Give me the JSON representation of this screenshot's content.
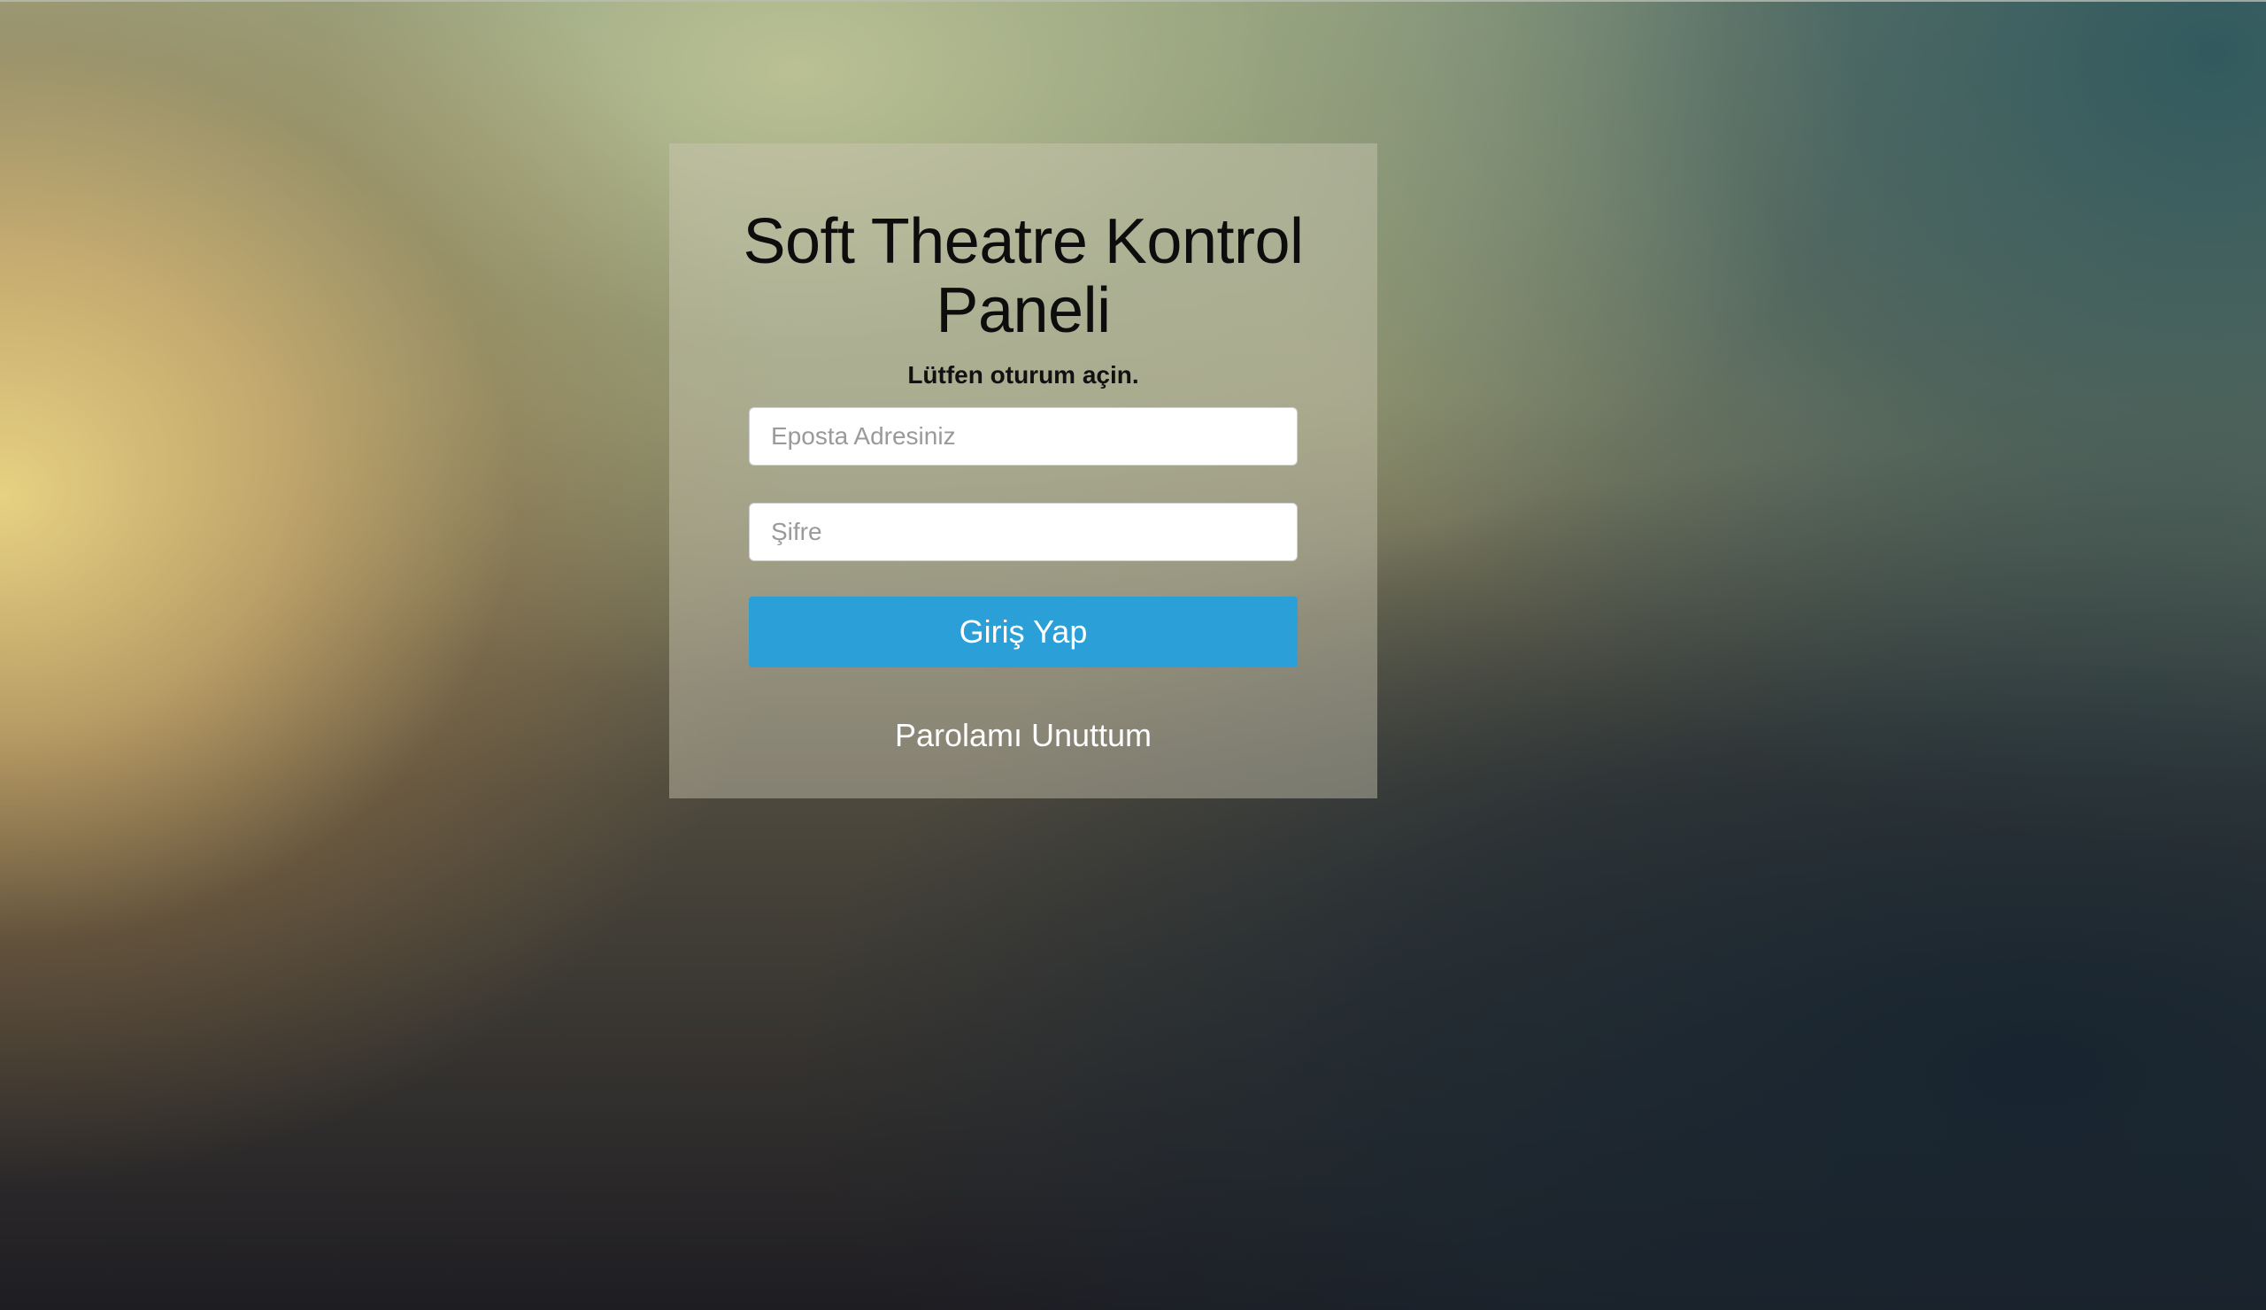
{
  "login": {
    "title": "Soft Theatre Kontrol Paneli",
    "subtitle": "Lütfen oturum açin.",
    "email_placeholder": "Eposta Adresiniz",
    "password_placeholder": "Şifre",
    "submit_label": "Giriş Yap",
    "forgot_link": "Parolamı Unuttum"
  },
  "colors": {
    "button": "#2a9fd8",
    "button_text": "#ffffff",
    "link": "#ffffff"
  }
}
